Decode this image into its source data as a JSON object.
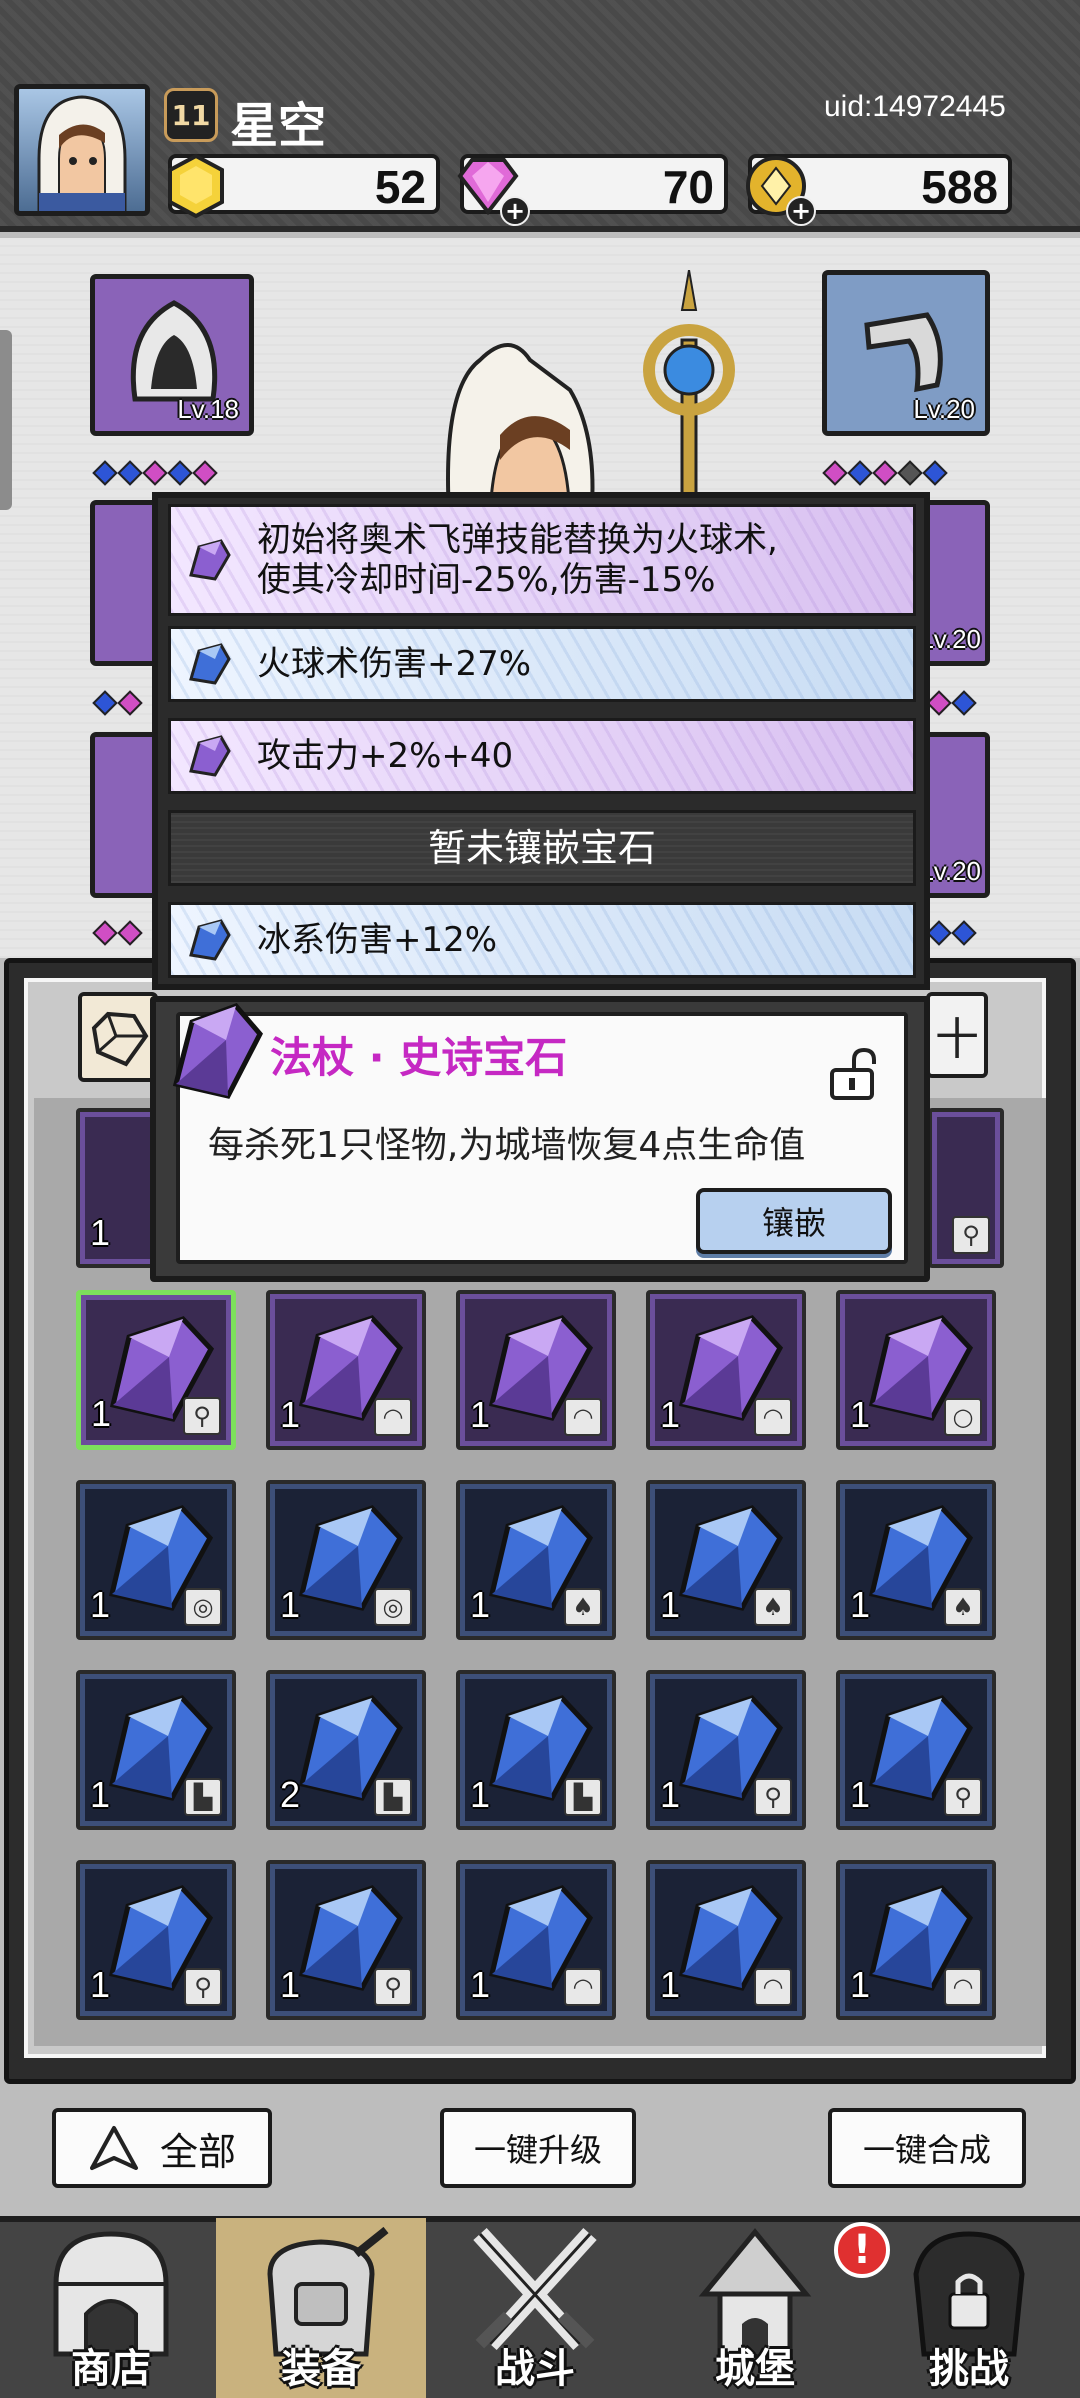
{
  "player": {
    "level": "11",
    "name": "星空",
    "uid": "uid:14972445"
  },
  "currencies": [
    {
      "name": "gold-hexagon",
      "value": "52"
    },
    {
      "name": "gem",
      "value": "70"
    },
    {
      "name": "coin",
      "value": "588"
    }
  ],
  "equipment": {
    "left_top_level": "Lv.18",
    "right_top_level": "Lv.20",
    "right_mid_level": "Lv.20",
    "right_bot_level": "Lv.20"
  },
  "gem_slots": [
    {
      "color": "purple",
      "text_line1": "初始将奥术飞弹技能替换为火球术,",
      "text_line2": "使其冷却时间-25%,伤害-15%"
    },
    {
      "color": "blue",
      "text": "火球术伤害+27%"
    },
    {
      "color": "purple",
      "text": "攻击力+2%+40"
    },
    {
      "color": "empty",
      "text": "暂未镶嵌宝石"
    },
    {
      "color": "blue",
      "text": "冰系伤害+12%"
    }
  ],
  "popup": {
    "title": "法杖 · 史诗宝石",
    "description": "每杀死1只怪物,为城墙恢复4点生命值",
    "button": "镶嵌"
  },
  "inventory": {
    "filter_right": "十",
    "rows": [
      [
        {
          "c": "purple",
          "n": "1",
          "t": "staff"
        },
        {
          "c": "purple",
          "n": "1",
          "t": "hat"
        },
        {
          "c": "purple",
          "n": "1",
          "t": "hat"
        },
        {
          "c": "purple",
          "n": "1",
          "t": "hat"
        },
        {
          "c": "purple",
          "n": "1",
          "t": "necklace"
        }
      ],
      [
        {
          "c": "blue",
          "n": "1",
          "t": "ring"
        },
        {
          "c": "blue",
          "n": "1",
          "t": "ring"
        },
        {
          "c": "blue",
          "n": "1",
          "t": "armor"
        },
        {
          "c": "blue",
          "n": "1",
          "t": "armor"
        },
        {
          "c": "blue",
          "n": "1",
          "t": "armor"
        }
      ],
      [
        {
          "c": "blue",
          "n": "1",
          "t": "boots"
        },
        {
          "c": "blue",
          "n": "2",
          "t": "boots"
        },
        {
          "c": "blue",
          "n": "1",
          "t": "boots"
        },
        {
          "c": "blue",
          "n": "1",
          "t": "staff"
        },
        {
          "c": "blue",
          "n": "1",
          "t": "staff"
        }
      ],
      [
        {
          "c": "blue",
          "n": "1",
          "t": "staff"
        },
        {
          "c": "blue",
          "n": "1",
          "t": "staff"
        },
        {
          "c": "blue",
          "n": "1",
          "t": "hat"
        },
        {
          "c": "blue",
          "n": "1",
          "t": "hat"
        },
        {
          "c": "blue",
          "n": "1",
          "t": "hat"
        }
      ]
    ],
    "top_partial": [
      {
        "c": "purple",
        "n": "1"
      },
      {
        "c": "purple",
        "n": "",
        "t": "staff"
      }
    ]
  },
  "actions": {
    "all": "全部",
    "upgrade": "一键升级",
    "merge": "一键合成"
  },
  "nav": {
    "shop": "商店",
    "equipment": "装备",
    "battle": "战斗",
    "castle": "城堡",
    "challenge": "挑战",
    "alert": "!"
  },
  "colors": {
    "purple_gem": "#8b5fd0",
    "blue_gem": "#3f6fd8",
    "popup_title": "#c528c3",
    "selected_border": "#7de05c"
  }
}
